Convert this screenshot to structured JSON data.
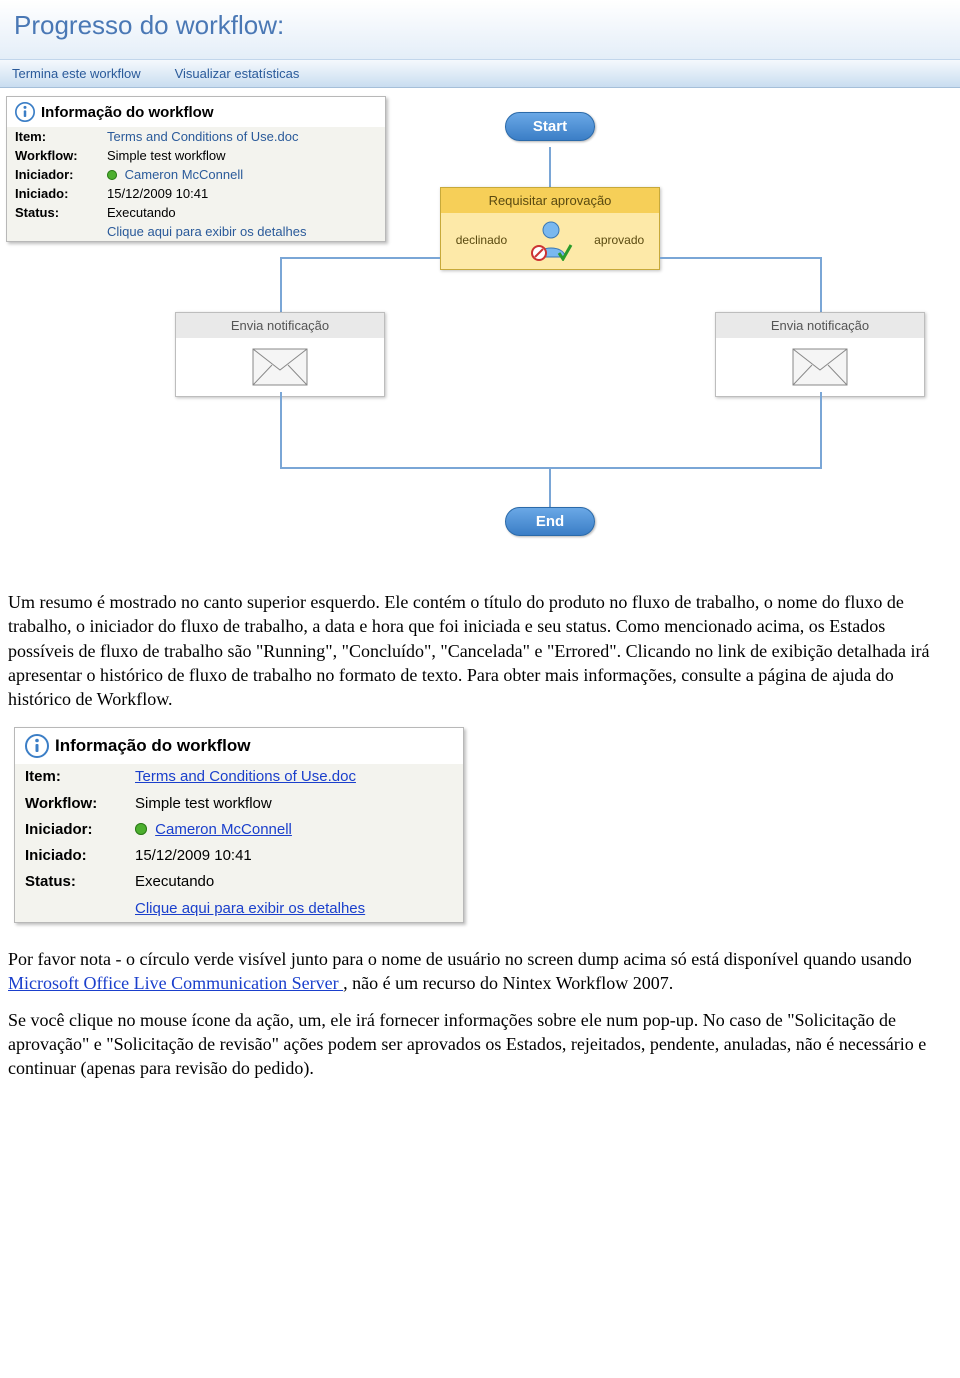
{
  "header": {
    "title": "Progresso do workflow:"
  },
  "toolbar": {
    "terminate": "Termina este workflow",
    "stats": "Visualizar estatísticas"
  },
  "info_panel": {
    "title": "Informação do workflow",
    "item_label": "Item:",
    "item_value": "Terms and Conditions of Use.doc",
    "workflow_label": "Workflow:",
    "workflow_value": "Simple test workflow",
    "initiator_label": "Iniciador:",
    "initiator_value": "Cameron McConnell",
    "started_label": "Iniciado:",
    "started_value": "15/12/2009 10:41",
    "status_label": "Status:",
    "status_value": "Executando",
    "details_link": "Clique aqui para exibir os detalhes"
  },
  "workflow": {
    "start": "Start",
    "end": "End",
    "approval_title": "Requisitar aprovação",
    "approval_declined": "declinado",
    "approval_approved": "aprovado",
    "notify_left": "Envia notificação",
    "notify_right": "Envia notificação"
  },
  "body": {
    "para1": "Um resumo é mostrado no canto superior esquerdo. Ele contém o título do produto no fluxo de trabalho, o nome do fluxo de trabalho, o iniciador do fluxo de trabalho, a data e hora que foi iniciada e seu status. Como mencionado acima, os Estados possíveis de fluxo de trabalho são \"Running\", \"Concluído\", \"Cancelada\" e \"Errored\". Clicando no link de exibição detalhada irá apresentar o histórico de fluxo de trabalho no formato de texto. Para obter mais informações, consulte a página de ajuda do histórico de Workflow.",
    "para2a": "Por favor nota - o círculo verde visível junto para o nome de usuário no screen dump acima só está disponível quando usando ",
    "para2_link": "Microsoft Office Live Communication Server ",
    "para2b": ", não é um recurso do Nintex Workflow 2007.",
    "para3": "Se você clique no mouse ícone da ação, um, ele irá fornecer informações sobre ele num pop-up. No caso de \"Solicitação de aprovação\" e \"Solicitação de revisão\" ações podem ser aprovados os Estados, rejeitados, pendente, anuladas, não é necessário e continuar (apenas para revisão do pedido)."
  }
}
